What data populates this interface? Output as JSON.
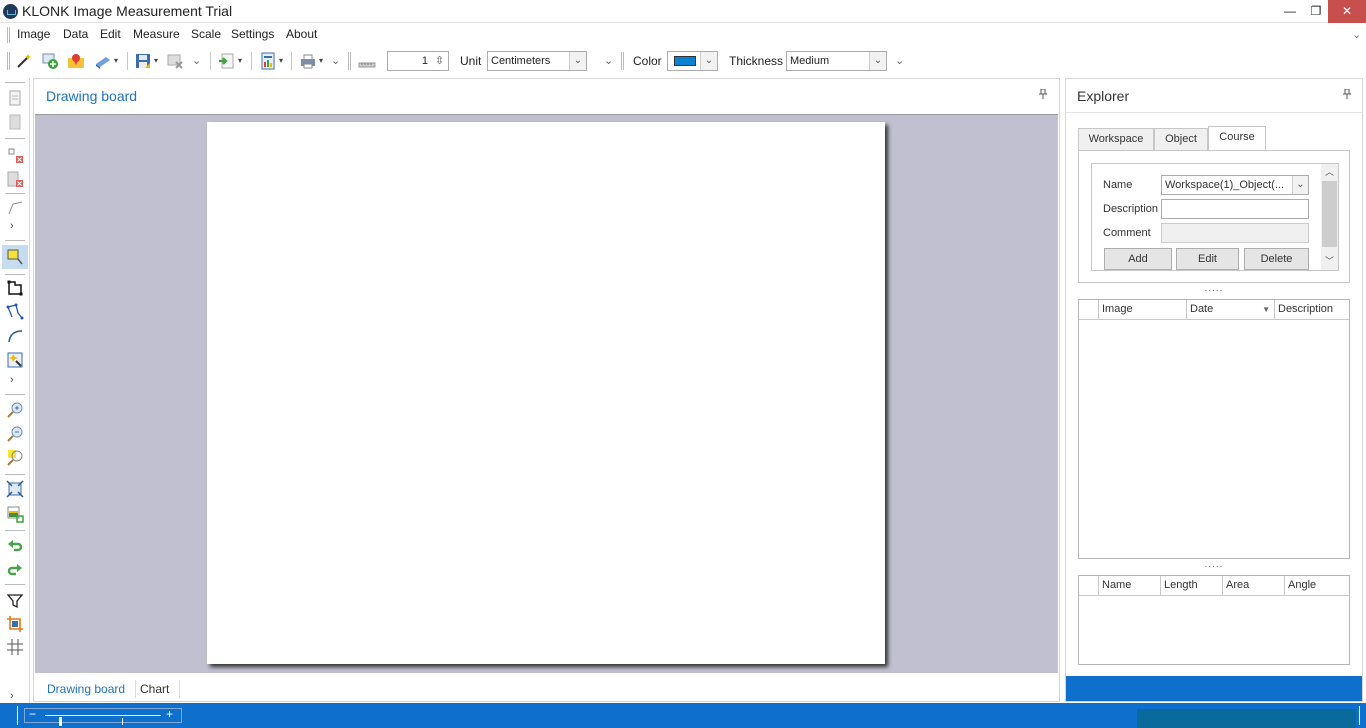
{
  "window": {
    "title": "KLONK Image Measurement Trial",
    "minimize_glyph": "—",
    "restore_glyph": "❐",
    "close_glyph": "✕"
  },
  "menu": {
    "items": [
      "Image",
      "Data",
      "Edit",
      "Measure",
      "Scale",
      "Settings",
      "About"
    ],
    "overflow_glyph": "⌄"
  },
  "toolbar": {
    "icons": [
      "magic-wand-icon",
      "add-image-icon",
      "map-marker-icon",
      "scanner-icon",
      "save-icon",
      "close-image-icon",
      "export-icon",
      "report-icon",
      "print-icon",
      "ruler-icon"
    ],
    "scale_value": "1",
    "unit_label": "Unit",
    "unit_value": "Centimeters",
    "color_label": "Color",
    "color_value": "#0a82d4",
    "thickness_label": "Thickness",
    "thickness_value": "Medium",
    "chev": "⌄",
    "caret": "▾",
    "spin_glyph": "⇳"
  },
  "left_tools": {
    "icons": [
      "new-document-icon",
      "page-icon",
      "delete-object-icon",
      "delete-page-icon",
      "line-tool-icon",
      "select-tool-icon",
      "rectangle-tool-icon",
      "polygon-tool-icon",
      "curve-tool-icon",
      "magic-select-icon",
      "zoom-in-icon",
      "zoom-out-icon",
      "zoom-fit-icon",
      "fit-screen-icon",
      "image-resize-icon",
      "undo-icon",
      "redo-icon",
      "filter-icon",
      "crop-icon",
      "grid-icon"
    ],
    "chevron": "›"
  },
  "document": {
    "title": "Drawing board",
    "pin_glyph": "📌",
    "tabs": [
      {
        "label": "Drawing board",
        "active": true
      },
      {
        "label": "Chart",
        "active": false
      }
    ]
  },
  "explorer": {
    "title": "Explorer",
    "tabs": [
      {
        "label": "Workspace",
        "active": false
      },
      {
        "label": "Object",
        "active": false
      },
      {
        "label": "Course",
        "active": true
      }
    ],
    "course_form": {
      "name_label": "Name",
      "name_value": "Workspace(1)_Object(...",
      "description_label": "Description",
      "description_value": "",
      "comment_label": "Comment",
      "comment_value": "",
      "buttons": {
        "add": "Add",
        "edit": "Edit",
        "delete": "Delete"
      }
    },
    "splitter_glyph": ".....",
    "images_grid": {
      "columns": [
        "Image",
        "Date",
        "Description"
      ],
      "sort_glyph": "▼",
      "rows": []
    },
    "objects_grid": {
      "columns": [
        "Name",
        "Length",
        "Area",
        "Angle"
      ],
      "rows": []
    }
  },
  "statusbar": {
    "zoom_minus": "−",
    "zoom_plus": "+",
    "zoom_level_fraction": 0.12
  },
  "colors": {
    "accent": "#0e6fcd",
    "canvas_bg": "#c1c0d1",
    "close_button": "#c7504f",
    "link_blue": "#1e73be"
  }
}
